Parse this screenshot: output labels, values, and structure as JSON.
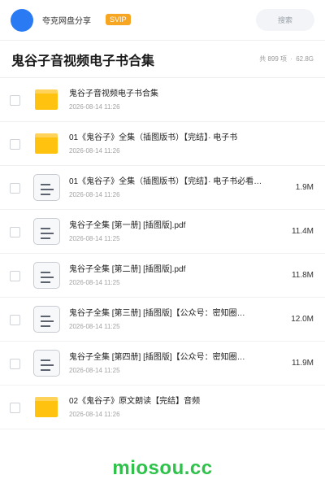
{
  "header": {
    "user_name": "夸克网盘分享",
    "vip_label": "SVIP",
    "search_placeholder": "搜索"
  },
  "title_bar": {
    "title": "鬼谷子音视频电子书合集",
    "count": "共 899 项",
    "separator": "·",
    "total_size": "62.8G"
  },
  "files": [
    {
      "type": "folder",
      "name": "鬼谷子音视频电子书合集",
      "date": "2026-08-14 11:26",
      "size": ""
    },
    {
      "type": "folder",
      "name": "01《鬼谷子》全集（插图版书）【完结】· 电子书",
      "date": "2026-08-14 11:26",
      "size": ""
    },
    {
      "type": "file",
      "name": "01《鬼谷子》全集（插图版书）【完结】· 电子书必看…",
      "date": "2026-08-14 11:26",
      "size": "1.9M"
    },
    {
      "type": "file",
      "name": "鬼谷子全集 [第一册] [插图版].pdf",
      "date": "2026-08-14 11:25",
      "size": "11.4M"
    },
    {
      "type": "file",
      "name": "鬼谷子全集 [第二册] [插图版].pdf",
      "date": "2026-08-14 11:25",
      "size": "11.8M"
    },
    {
      "type": "file",
      "name": "鬼谷子全集 [第三册] [插图版]【公众号：密知圈…",
      "date": "2026-08-14 11:25",
      "size": "12.0M"
    },
    {
      "type": "file",
      "name": "鬼谷子全集 [第四册] [插图版]【公众号：密知圈…",
      "date": "2026-08-14 11:25",
      "size": "11.9M"
    },
    {
      "type": "folder",
      "name": "02《鬼谷子》原文朗读【完结】音频",
      "date": "2026-08-14 11:26",
      "size": ""
    }
  ],
  "watermark": "miosou.cc",
  "colors": {
    "avatar": "#2a7af3",
    "vip_badge": "#f6a623",
    "folder": "#ffc20e",
    "watermark": "#2ec24a"
  }
}
